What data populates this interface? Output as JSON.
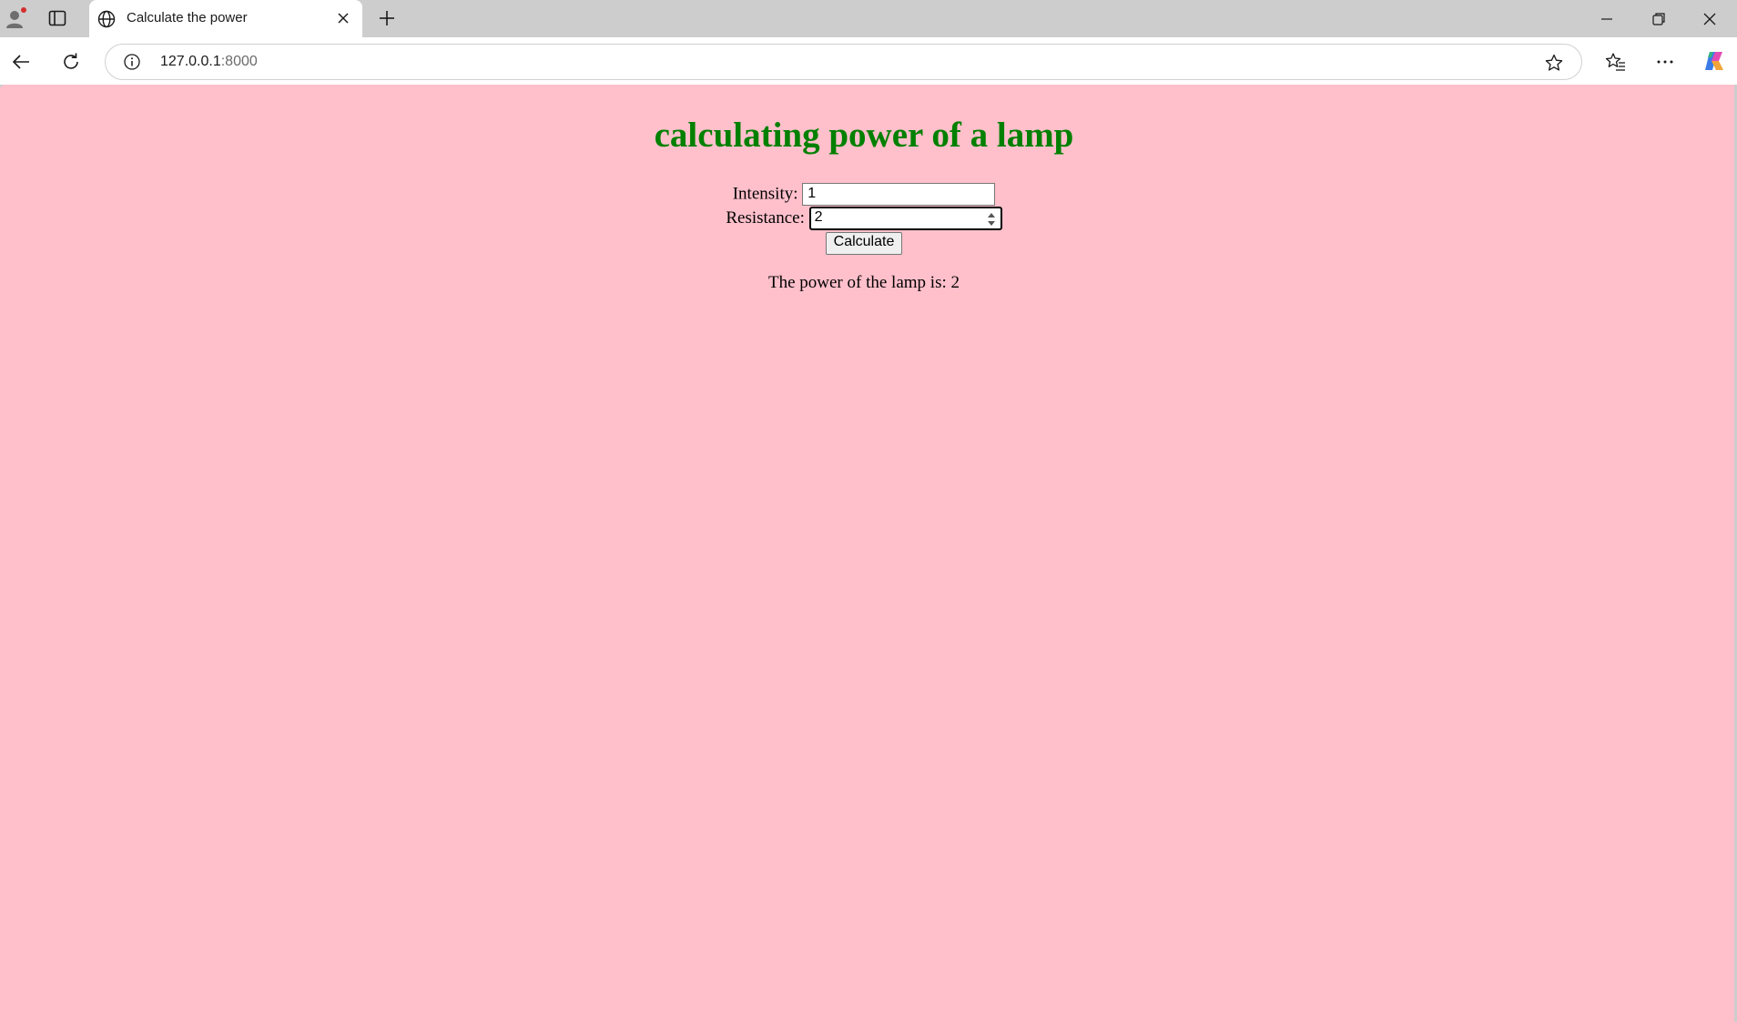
{
  "browser": {
    "tab_title": "Calculate the power",
    "url_host": "127.0.0.1",
    "url_port": ":8000"
  },
  "page": {
    "heading": "calculating power of a lamp",
    "intensity_label": "Intensity:",
    "intensity_value": "1",
    "resistance_label": "Resistance:",
    "resistance_value": "2",
    "calculate_label": "Calculate",
    "result_text": "The power of the lamp is: 2"
  },
  "colors": {
    "page_background": "#ffc0cb",
    "heading": "#008000"
  },
  "icons": [
    "profile-icon",
    "tab-actions-icon",
    "globe-icon",
    "close-icon",
    "plus-icon",
    "minimize-icon",
    "restore-icon",
    "window-close-icon",
    "back-arrow-icon",
    "reload-icon",
    "info-icon",
    "star-icon",
    "favorites-icon",
    "more-icon",
    "copilot-icon"
  ]
}
